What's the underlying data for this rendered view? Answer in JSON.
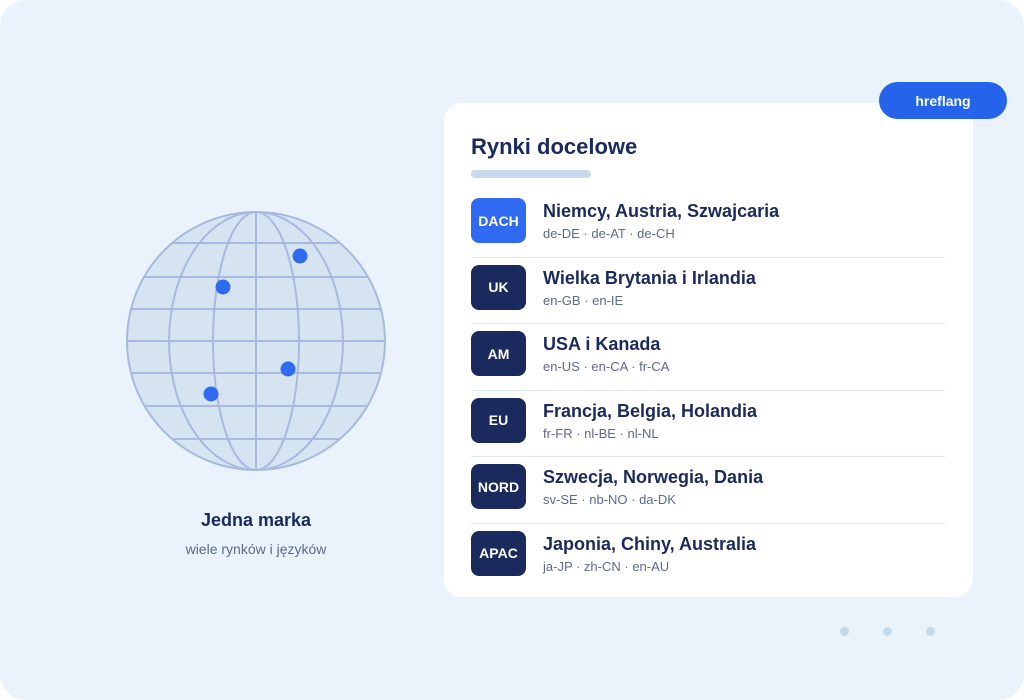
{
  "left_panel": {
    "title": "Jedna marka",
    "subtitle": "wiele rynków i języków"
  },
  "card": {
    "title": "Rynki docelowe",
    "tag": "hreflang",
    "markets": [
      {
        "badge": "DACH",
        "title": "Niemcy, Austria, Szwajcaria",
        "codes": "de-DE · de-AT · de-CH"
      },
      {
        "badge": "UK",
        "title": "Wielka Brytania i Irlandia",
        "codes": "en-GB · en-IE"
      },
      {
        "badge": "AM",
        "title": "USA i Kanada",
        "codes": "en-US · en-CA · fr-CA"
      },
      {
        "badge": "EU",
        "title": "Francja, Belgia, Holandia",
        "codes": "fr-FR · nl-BE · nl-NL"
      },
      {
        "badge": "NORD",
        "title": "Szwecja, Norwegia, Dania",
        "codes": "sv-SE · nb-NO · da-DK"
      },
      {
        "badge": "APAC",
        "title": "Japonia, Chiny, Australia",
        "codes": "ja-JP · zh-CN · en-AU"
      }
    ]
  },
  "colors": {
    "background": "#eaf2fb",
    "navy": "#1b2a5c",
    "accent_blue": "#2f6af0",
    "globe_fill": "#d6e3f1",
    "globe_line": "#a7b9e0"
  },
  "icons": {
    "globe": "globe-icon",
    "pagination": "pagination-dots-icon"
  }
}
